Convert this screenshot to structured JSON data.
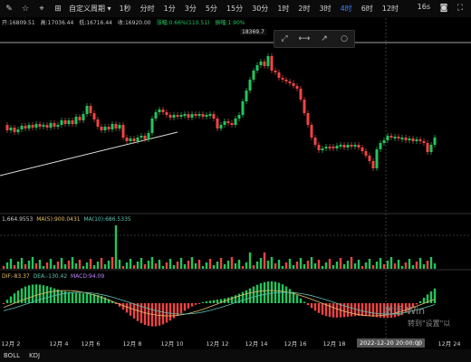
{
  "toolbar": {
    "indicator_menu": "自定义周期",
    "periods": [
      "1秒",
      "分时",
      "1分",
      "3分",
      "5分",
      "15分",
      "30分",
      "1时",
      "2时",
      "3时",
      "4时",
      "6时",
      "12时"
    ],
    "active_period": "4时",
    "right_items": [
      "16s"
    ],
    "icons": [
      "pencil-icon",
      "star-icon",
      "crosshair-icon",
      "indicator-icon"
    ]
  },
  "ohlc": {
    "open": "开:16809.51",
    "high": "高:17036.44",
    "low": "低:16716.44",
    "close": "收:16920.00",
    "change": "涨幅:0.66%(110.51)",
    "amplitude": "振幅:1.90%"
  },
  "price_tag": "18369.7",
  "volume_legend": {
    "vol": "1,664.9553",
    "ma5": "MA(5):900.0431",
    "ma10": "MA(10):686.5335"
  },
  "macd_legend": {
    "dif": "DIF:-83.37",
    "dea": "DEA:-130.42",
    "macd": "MACD:94.09"
  },
  "dates": [
    "12月 2",
    "12月 4",
    "12月 6",
    "12月 8",
    "12月 10",
    "12月 12",
    "12月 14",
    "12月 16",
    "12月 18",
    "12月 24"
  ],
  "cursor_date": "2022-12-20 20:00:00",
  "cursor_date_suffix": "2",
  "bottom_tabs": [
    "BOLL",
    "KDJ"
  ],
  "watermark": {
    "line1": "激活 Win",
    "line2": "转到\"设置\"以"
  },
  "colors": {
    "up": "#22c55e",
    "down": "#ef4444",
    "active": "#3b82f6",
    "ma5": "#e6c068",
    "ma10": "#5cc3b0"
  }
}
